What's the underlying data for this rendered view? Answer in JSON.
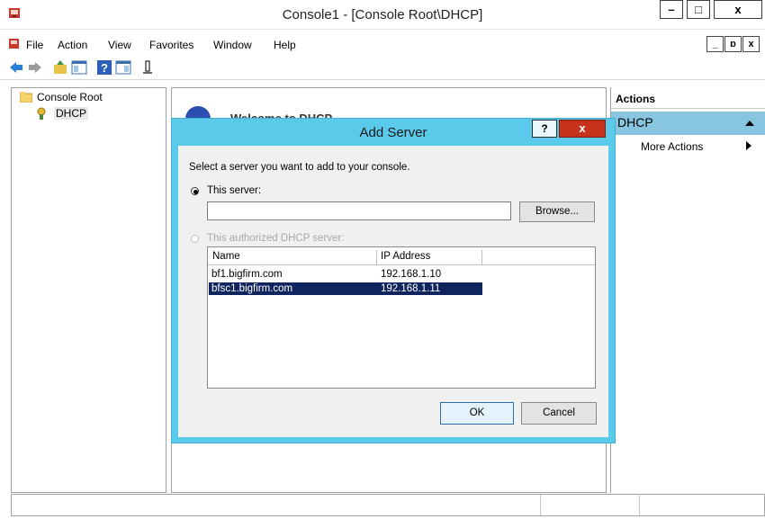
{
  "window": {
    "title": "Console1 - [Console Root\\DHCP]",
    "minimize": "–",
    "maximize": "□",
    "close": "x"
  },
  "menu": {
    "items": [
      "File",
      "Action",
      "View",
      "Favorites",
      "Window",
      "Help"
    ],
    "mdi": {
      "minimize": "_",
      "restore": "ɒ",
      "close": "x"
    }
  },
  "toolbar": {
    "icons": [
      "back-arrow-icon",
      "forward-arrow-icon",
      "up-folder-icon",
      "show-hide-tree-icon",
      "help-icon",
      "show-hide-action-pane-icon",
      "properties-icon"
    ]
  },
  "tree": {
    "root": "Console Root",
    "child": "DHCP"
  },
  "center": {
    "welcome": "Welcome to DHCP"
  },
  "actions": {
    "header": "Actions",
    "section": "DHCP",
    "more": "More Actions"
  },
  "dialog": {
    "title": "Add Server",
    "help": "?",
    "close": "x",
    "instruction": "Select a server you want to add to your console.",
    "radio_this_server": "This server:",
    "server_input_value": "",
    "browse": "Browse...",
    "radio_authorized": "This authorized DHCP server:",
    "columns": [
      "Name",
      "IP Address"
    ],
    "rows": [
      {
        "name": "bf1.bigfirm.com",
        "ip": "192.168.1.10",
        "selected": false
      },
      {
        "name": "bfsc1.bigfirm.com",
        "ip": "192.168.1.11",
        "selected": true
      }
    ],
    "ok": "OK",
    "cancel": "Cancel"
  },
  "colors": {
    "dialog_frame": "#5ac9ea",
    "selection": "#10245e",
    "actions_highlight": "#88c5e0",
    "close_red": "#c7321c"
  }
}
